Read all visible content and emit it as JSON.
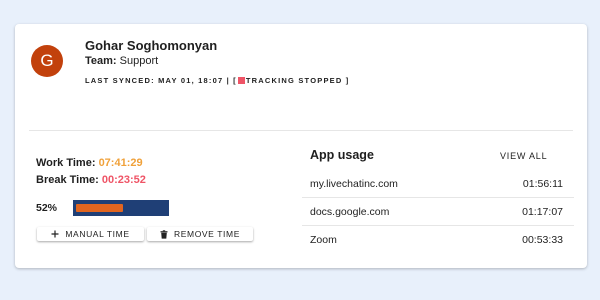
{
  "user": {
    "initial": "G",
    "name": "Gohar Soghomonyan",
    "team_label": "Team:",
    "team_value": "Support",
    "avatar_color": "#c2410c"
  },
  "sync": {
    "prefix": "LAST SYNCED: MAY 01, 18:07 | [",
    "status": "TRACKING STOPPED ]",
    "status_color": "#ef5466"
  },
  "time": {
    "work_label": "Work Time:",
    "work_value": "07:41:29",
    "work_color": "#f0a13a",
    "break_label": "Break Time:",
    "break_value": "00:23:52",
    "break_color": "#ef5466"
  },
  "progress": {
    "label": "52%",
    "fraction": 0.52,
    "fill_color": "#e1651f",
    "track_color": "#1f3f76"
  },
  "buttons": {
    "manual_time": "MANUAL TIME",
    "manual_icon": "plus-icon",
    "remove_time": "REMOVE TIME",
    "remove_icon": "trash-icon"
  },
  "app_usage": {
    "title": "App usage",
    "view_all": "VIEW ALL",
    "rows": [
      {
        "app": "my.livechatinc.com",
        "duration": "01:56:11"
      },
      {
        "app": "docs.google.com",
        "duration": "01:17:07"
      },
      {
        "app": "Zoom",
        "duration": "00:53:33"
      }
    ]
  }
}
